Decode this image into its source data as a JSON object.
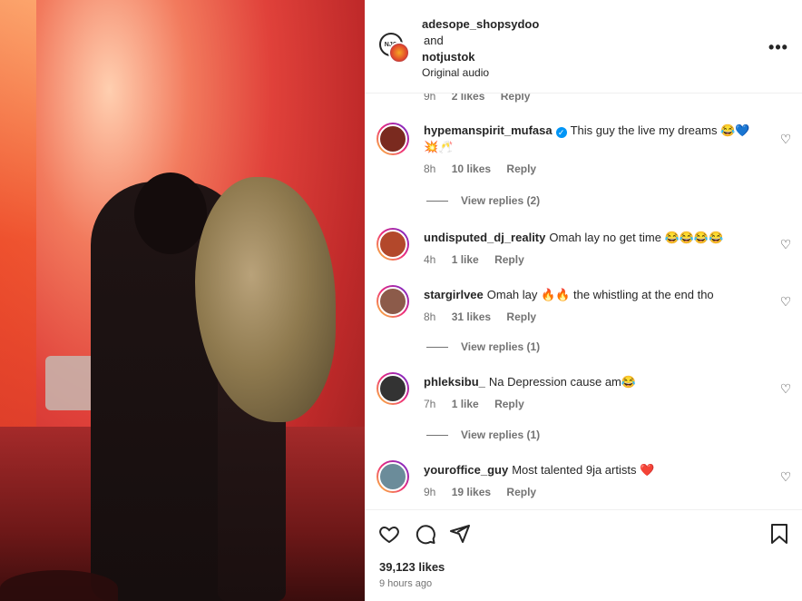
{
  "post": {
    "author_1": "adesope_shopsydoo",
    "conjunction": "and",
    "author_2": "notjustok",
    "audio": "Original audio",
    "more_icon": "•••"
  },
  "partial_comment": {
    "time": "9h",
    "likes": "2 likes",
    "reply": "Reply"
  },
  "comments": [
    {
      "user": "hypemanspirit_mufasa",
      "verified": true,
      "text": "This guy the live my dreams 😂💙💥🥂",
      "time": "8h",
      "likes": "10 likes",
      "reply": "Reply",
      "view_replies": "View replies (2)",
      "avatar_color": "#7a2a1f"
    },
    {
      "user": "undisputed_dj_reality",
      "text": "Omah lay no get time 😂😂😂😂",
      "time": "4h",
      "likes": "1 like",
      "reply": "Reply",
      "avatar_color": "#b3482b"
    },
    {
      "user": "stargirlvee",
      "text": "Omah lay 🔥🔥 the whistling at the end tho",
      "time": "8h",
      "likes": "31 likes",
      "reply": "Reply",
      "view_replies": "View replies (1)",
      "avatar_color": "#8c5b4a"
    },
    {
      "user": "phleksibu_",
      "text": "Na Depression cause am😂",
      "time": "7h",
      "likes": "1 like",
      "reply": "Reply",
      "view_replies": "View replies (1)",
      "avatar_color": "#333333"
    },
    {
      "user": "youroffice_guy",
      "text": "Most talented 9ja artists ❤️",
      "time": "9h",
      "likes": "19 likes",
      "reply": "Reply",
      "avatar_color": "#6b8c9a"
    }
  ],
  "footer": {
    "likes": "39,123 likes",
    "time_ago": "9 hours ago"
  },
  "colors": {
    "text": "#262626",
    "muted": "#737373",
    "verified": "#0095f6"
  }
}
